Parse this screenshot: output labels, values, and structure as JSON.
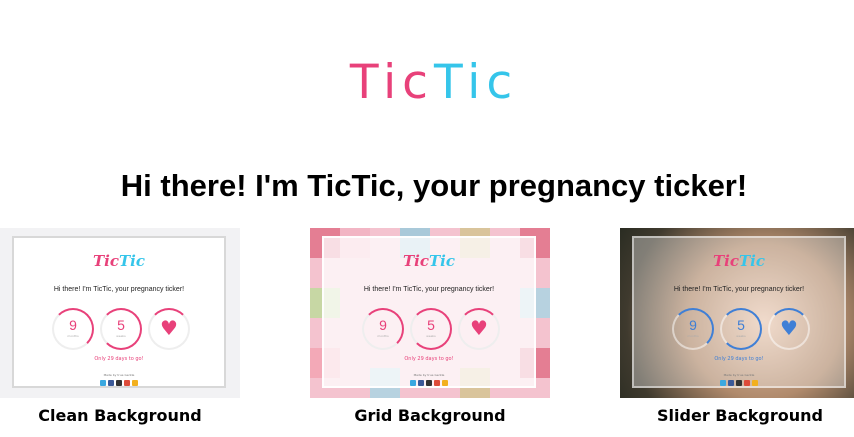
{
  "header": {
    "logo_part1": "Tic",
    "logo_part2": "Tic",
    "headline": "Hi there! I'm TicTic, your pregnancy ticker!"
  },
  "cards": [
    {
      "label": "Clean Background",
      "preview": {
        "logo_part1": "Tic",
        "logo_part2": "Tic",
        "headline": "Hi there! I'm TicTic, your pregnancy ticker!",
        "months": "9",
        "months_unit": "months",
        "weeks": "5",
        "weeks_unit": "weeks",
        "countdown": "Only 29 days to go!",
        "madeby": "Made by true Gentle"
      },
      "accent": "#e8417a"
    },
    {
      "label": "Grid Background",
      "preview": {
        "logo_part1": "Tic",
        "logo_part2": "Tic",
        "headline": "Hi there! I'm TicTic, your pregnancy ticker!",
        "months": "9",
        "months_unit": "months",
        "weeks": "5",
        "weeks_unit": "weeks",
        "countdown": "Only 29 days to go!",
        "madeby": "Made by true Gentle"
      },
      "accent": "#e8417a"
    },
    {
      "label": "Slider Background",
      "preview": {
        "logo_part1": "Tic",
        "logo_part2": "Tic",
        "headline": "Hi there! I'm TicTic, your pregnancy ticker!",
        "months": "9",
        "months_unit": "months",
        "weeks": "5",
        "weeks_unit": "weeks",
        "countdown": "Only 29 days to go!",
        "madeby": "Made by true Gentle"
      },
      "accent": "#3f7fd6"
    }
  ],
  "colors": {
    "pink": "#e8417a",
    "cyan": "#35c5ea",
    "blue": "#3f7fd6"
  }
}
